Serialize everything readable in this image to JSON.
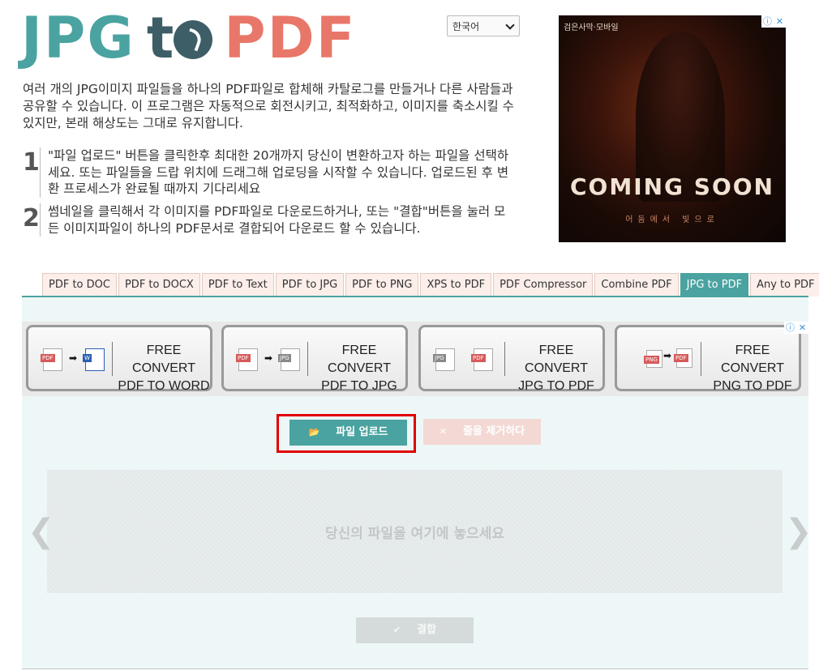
{
  "logo": {
    "part1": "JPG",
    "part2": "t",
    "part3": "PDF"
  },
  "language": {
    "selected": "한국어"
  },
  "ad_top": {
    "tag": "검은사막·모바일",
    "headline": "COMING SOON",
    "sub": "어둠에서 빛으로",
    "info_icon": "ⓘ",
    "close_icon": "✕"
  },
  "description": "여러 개의 JPG이미지 파일들을 하나의 PDF파일로 합체해 카탈로그를 만들거나 다른 사람들과 공유할 수 있습니다. 이 프로그램은 자동적으로 회전시키고, 최적화하고, 이미지를 축소시킬 수 있지만, 본래 해상도는 그대로 유지합니다.",
  "steps": [
    {
      "num": "1",
      "text": "\"파일 업로드\" 버튼을 클릭한후 최대한 20개까지 당신이 변환하고자 하는 파일을 선택하세요. 또는 파일들을 드랍 위치에 드래그해 업로딩을 시작할 수 있습니다. 업로드된 후 변환 프로세스가 완료될 때까지 기다리세요"
    },
    {
      "num": "2",
      "text": "썸네일을 클릭해서 각 이미지를 PDF파일로 다운로드하거나, 또는 \"결합\"버튼을 눌러 모든 이미지파일이 하나의 PDF문서로 결합되어 다운로드 할 수 있습니다."
    }
  ],
  "tabs": [
    {
      "label": "PDF to DOC"
    },
    {
      "label": "PDF to DOCX"
    },
    {
      "label": "PDF to Text"
    },
    {
      "label": "PDF to JPG"
    },
    {
      "label": "PDF to PNG"
    },
    {
      "label": "XPS to PDF"
    },
    {
      "label": "PDF Compressor"
    },
    {
      "label": "Combine PDF"
    },
    {
      "label": "JPG to PDF",
      "active": true
    },
    {
      "label": "Any to PDF"
    }
  ],
  "banner": {
    "cards": [
      {
        "line1": "FREE CONVERT",
        "line2": "PDF TO WORD",
        "from": "PDF",
        "to": "W"
      },
      {
        "line1": "FREE CONVERT",
        "line2": "PDF TO JPG",
        "from": "PDF",
        "to": "JPG"
      },
      {
        "line1": "FREE CONVERT",
        "line2": "JPG TO PDF",
        "from": "JPG",
        "to": "PDF"
      },
      {
        "line1": "FREE CONVERT",
        "line2": "PNG TO PDF",
        "from": "PNG",
        "to": "PDF"
      }
    ]
  },
  "buttons": {
    "upload": "파일 업로드",
    "remove": "줄을 제거하다",
    "combine": "결합"
  },
  "dropzone": {
    "text": "당신의 파일을 여기에 놓으세요"
  },
  "nav": {
    "prev": "❮",
    "next": "❯"
  }
}
